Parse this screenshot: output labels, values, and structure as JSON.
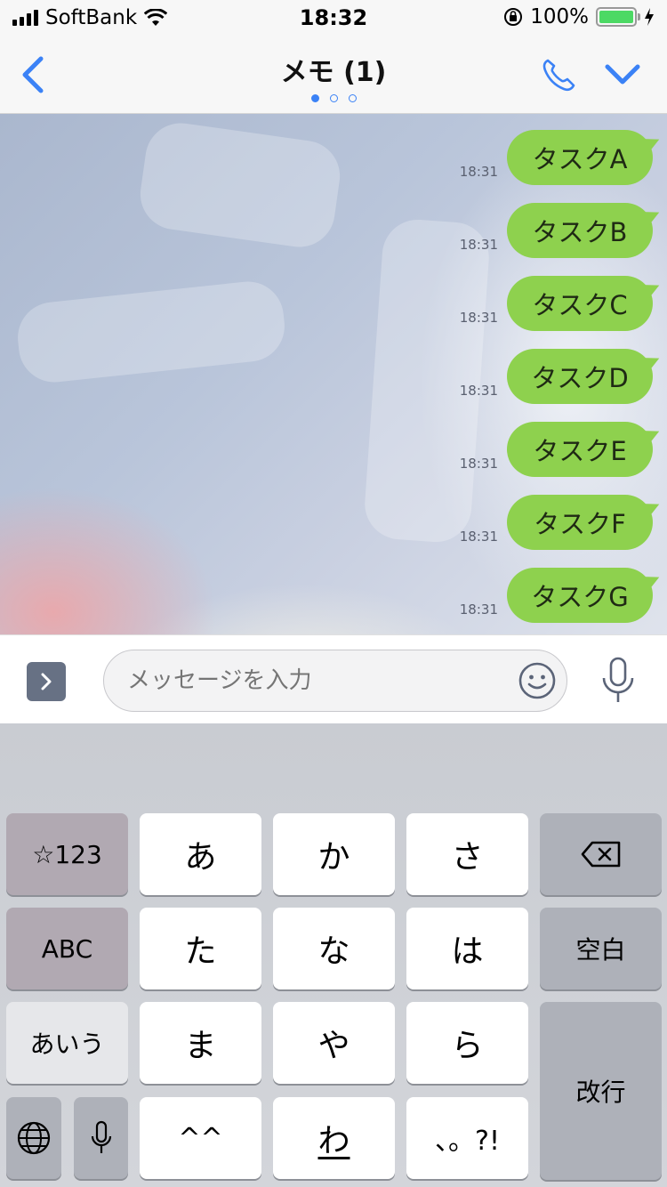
{
  "status_bar": {
    "carrier": "SoftBank",
    "time": "18:32",
    "battery": "100%",
    "battery_level": 1.0
  },
  "nav": {
    "title": "メモ (1)",
    "page_count": 3,
    "active_page": 0,
    "accent": "#3b82f6"
  },
  "messages": [
    {
      "text": "タスクA",
      "time": "18:31"
    },
    {
      "text": "タスクB",
      "time": "18:31"
    },
    {
      "text": "タスクC",
      "time": "18:31"
    },
    {
      "text": "タスクD",
      "time": "18:31"
    },
    {
      "text": "タスクE",
      "time": "18:31"
    },
    {
      "text": "タスクF",
      "time": "18:31"
    },
    {
      "text": "タスクG",
      "time": "18:31"
    }
  ],
  "input": {
    "placeholder": "メッセージを入力"
  },
  "keyboard": {
    "symbols": "☆123",
    "abc": "ABC",
    "aiu": "あいう",
    "row1": [
      "あ",
      "か",
      "さ"
    ],
    "row2": [
      "た",
      "な",
      "は"
    ],
    "row3": [
      "ま",
      "や",
      "ら"
    ],
    "row4": [
      "^^",
      "わ",
      "、。?!"
    ],
    "space": "空白",
    "enter": "改行"
  },
  "colors": {
    "bubble": "#8ed14e",
    "battery": "#4cd964"
  }
}
